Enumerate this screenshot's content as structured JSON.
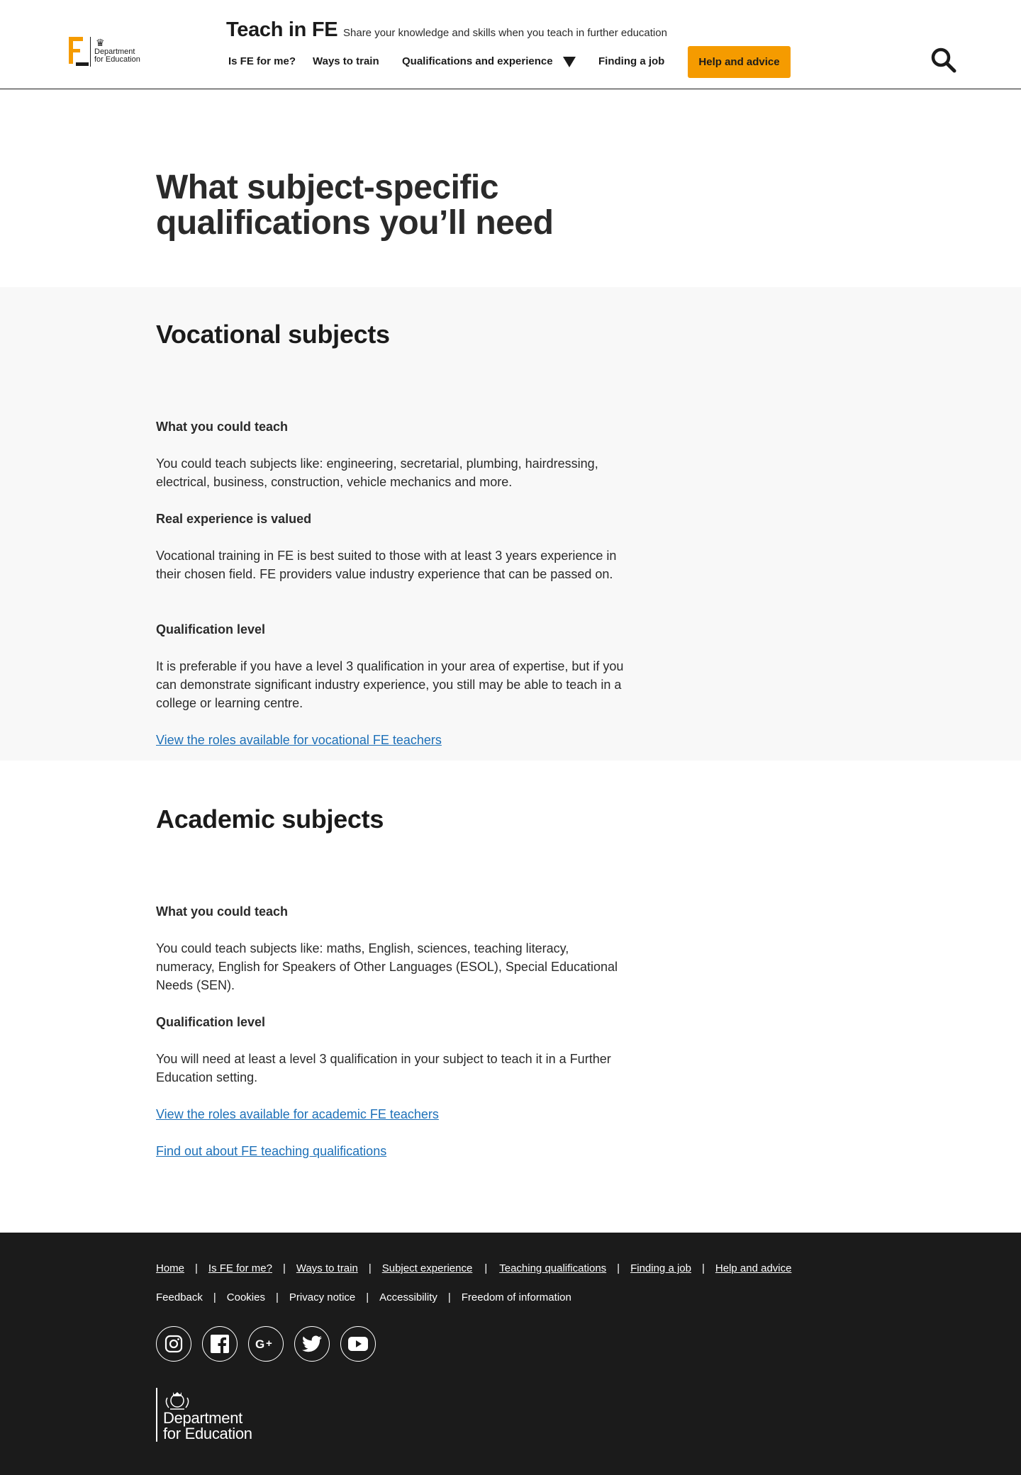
{
  "header": {
    "logo_text": "Department for Education",
    "site_title": "Teach in FE",
    "tagline": "Share your knowledge and skills when you teach in further education",
    "nav": {
      "is_fe": "Is FE for me?",
      "ways": "Ways to train",
      "quals": "Qualifications and experience",
      "finding": "Finding a job",
      "help": "Help and advice"
    },
    "search_icon": "search-icon"
  },
  "hero": {
    "title": "What subject-specific qualifications you’ll need"
  },
  "vocational": {
    "heading": "Vocational subjects",
    "teach_heading": "What you could teach",
    "teach_text": "You could teach subjects like: engineering, secretarial, plumbing, hairdressing, electrical, business, construction, vehicle mechanics and more.",
    "experience_heading": "Real experience is valued",
    "experience_text": "Vocational training in FE is best suited to those with at least 3 years experience in their chosen field. FE providers value industry experience that can be passed on.",
    "level_heading": "Qualification level",
    "level_text": "It is preferable if you have a level 3 qualification in your area of expertise, but if you can demonstrate significant industry experience, you still may be able to teach in a college or learning centre.",
    "roles_link": "View the roles available for vocational FE teachers"
  },
  "academic": {
    "heading": "Academic subjects",
    "teach_heading": "What you could teach",
    "teach_text": "You could teach subjects like: maths, English, sciences, teaching literacy, numeracy, English for Speakers of Other Languages (ESOL), Special Educational Needs (SEN).",
    "level_heading": "Qualification level",
    "level_text": "You will need at least a level 3 qualification in your subject to teach it in a Further Education setting.",
    "roles_link": "View the roles available for academic FE teachers",
    "quals_link": "Find out about FE teaching qualifications"
  },
  "footer": {
    "links": {
      "home": "Home",
      "is_fe": "Is FE for me?",
      "ways": "Ways to train",
      "subject": "Subject experience",
      "teaching_quals": "Teaching qualifications",
      "finding": "Finding a job",
      "help": "Help and advice"
    },
    "secondary": {
      "feedback": "Feedback",
      "cookies": "Cookies",
      "privacy": "Privacy notice",
      "accessibility": "Accessibility",
      "foi": "Freedom of information"
    },
    "separator": "|",
    "social_icons": [
      "instagram-icon",
      "facebook-icon",
      "google-plus-icon",
      "twitter-icon",
      "youtube-icon"
    ],
    "dfe_line1": "Department",
    "dfe_line2": "for Education"
  },
  "colors": {
    "accent": "#f59b00",
    "link": "#1d70b8",
    "footer_bg": "#1b1b1b",
    "section_grey": "#f8f8f8"
  }
}
